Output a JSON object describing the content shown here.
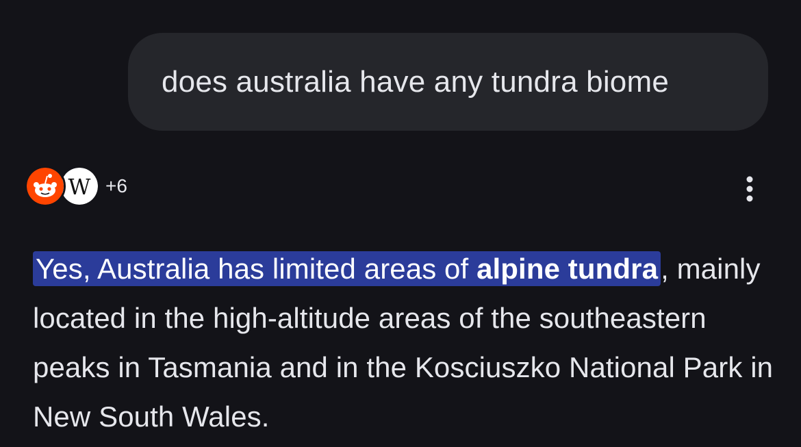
{
  "query": {
    "text": "does australia have any tundra biome"
  },
  "sources": {
    "icons": [
      "reddit-icon",
      "wikipedia-icon"
    ],
    "wiki_letter": "W",
    "more_count": "+6"
  },
  "menu": {
    "icon": "more-vert-icon"
  },
  "answer": {
    "highlight_plain": "Yes, Australia has limited areas of ",
    "highlight_bold": "alpine tundra",
    "rest": ", mainly located in the high-altitude areas of the southeastern peaks in Tasmania and in the Kosciuszko National Park in New South Wales."
  },
  "colors": {
    "background": "#131318",
    "bubble": "#25262b",
    "highlight": "#2b3c9a",
    "reddit": "#ff4500"
  }
}
